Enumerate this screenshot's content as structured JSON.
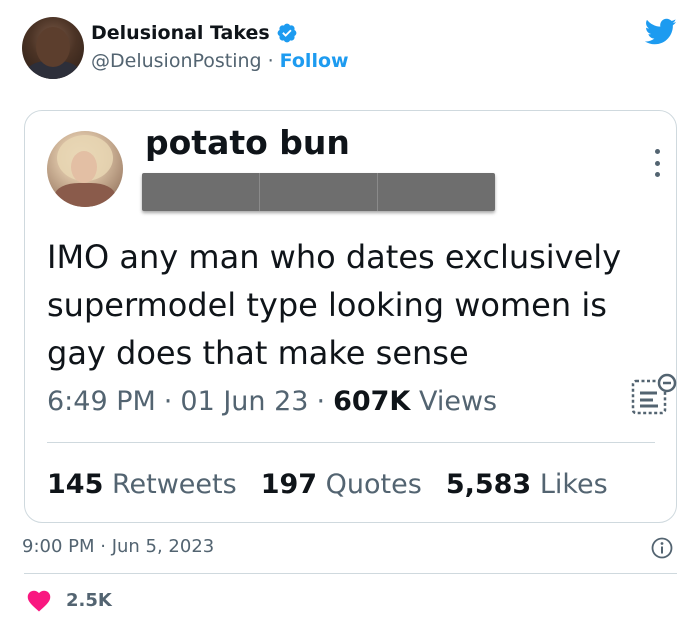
{
  "author": {
    "name": "Delusional Takes",
    "handle": "@DelusionPosting",
    "separator": "·",
    "follow_label": "Follow",
    "verified_color": "#1d9bf0",
    "brand_icon": "twitter-bird-icon"
  },
  "quoted_tweet": {
    "name": "potato bun",
    "text": "IMO any man who dates exclusively supermodel type looking women is gay does that make sense",
    "time": "6:49 PM",
    "date": "01 Jun 23",
    "views_count": "607K",
    "views_label": "Views",
    "stats": {
      "retweets_count": "145",
      "retweets_label": "Retweets",
      "quotes_count": "197",
      "quotes_label": "Quotes",
      "likes_count": "5,583",
      "likes_label": "Likes"
    }
  },
  "footer": {
    "timestamp": "9:00 PM · Jun 5, 2023",
    "likes": "2.5K",
    "heart_color": "#f91880"
  }
}
